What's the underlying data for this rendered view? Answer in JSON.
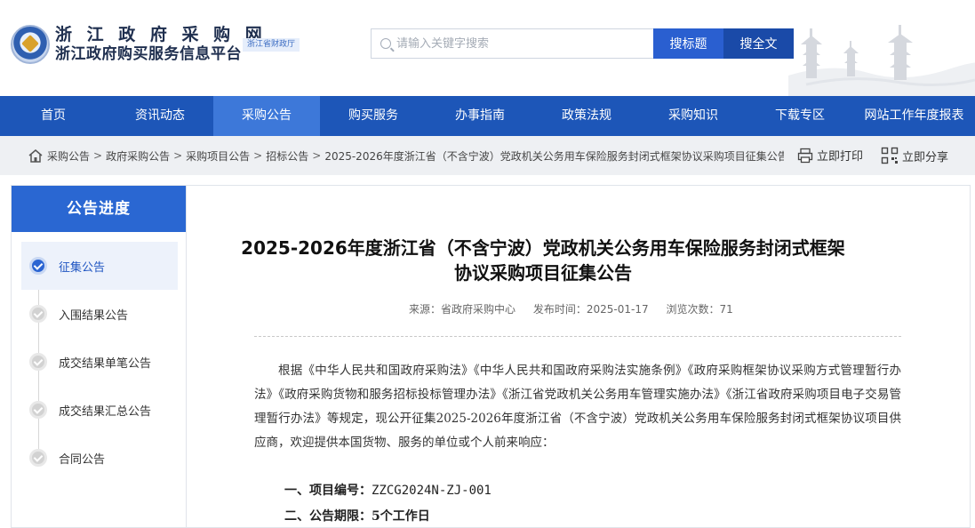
{
  "site": {
    "title": "浙 江 政 府 采 购 网",
    "subtitle": "浙江政府购买服务信息平台",
    "badge": "浙江省财政厅"
  },
  "search": {
    "placeholder": "请输入关键字搜索",
    "btn_title": "搜标题",
    "btn_full": "搜全文"
  },
  "nav": {
    "items": [
      "首页",
      "资讯动态",
      "采购公告",
      "购买服务",
      "办事指南",
      "政策法规",
      "采购知识",
      "下载专区",
      "网站工作年度报表"
    ],
    "active": "采购公告"
  },
  "breadcrumb": {
    "items": [
      "采购公告",
      "政府采购公告",
      "采购项目公告",
      "招标公告"
    ],
    "current": "2025-2026年度浙江省（不含宁波）党政机关公务用车保险服务封闭式框架协议采购项目征集公告",
    "separator": ">",
    "print": "立即打印",
    "share": "立即分享"
  },
  "sidebar": {
    "heading": "公告进度",
    "steps": [
      "征集公告",
      "入围结果公告",
      "成交结果单笔公告",
      "成交结果汇总公告",
      "合同公告"
    ],
    "active_step": "征集公告"
  },
  "article": {
    "title": "2025-2026年度浙江省（不含宁波）党政机关公务用车保险服务封闭式框架协议采购项目征集公告",
    "source_label": "来源：",
    "source": "省政府采购中心",
    "date_label": "发布时间：",
    "date": "2025-01-17",
    "views_label": "浏览次数：",
    "views": "71",
    "intro": "根据《中华人民共和国政府采购法》《中华人民共和国政府采购法实施条例》《政府采购框架协议采购方式管理暂行办法》《政府采购货物和服务招标投标管理办法》《浙江省党政机关公务用车管理实施办法》《浙江省政府采购项目电子交易管理暂行办法》等规定，现公开征集2025-2026年度浙江省（不含宁波）党政机关公务用车保险服务封闭式框架协议项目供应商，欢迎提供本国货物、服务的单位或个人前来响应：",
    "item1_label": "一、项目编号：",
    "item1_value": "ZZCG2024N-ZJ-001",
    "item2_label": "二、公告期限：",
    "item2_value": "5个工作日"
  },
  "colors": {
    "primary": "#1d56b8",
    "nav_active": "#3d78d9",
    "sidebar_head": "#2a67d2",
    "btn_full": "#1a4aa8"
  }
}
